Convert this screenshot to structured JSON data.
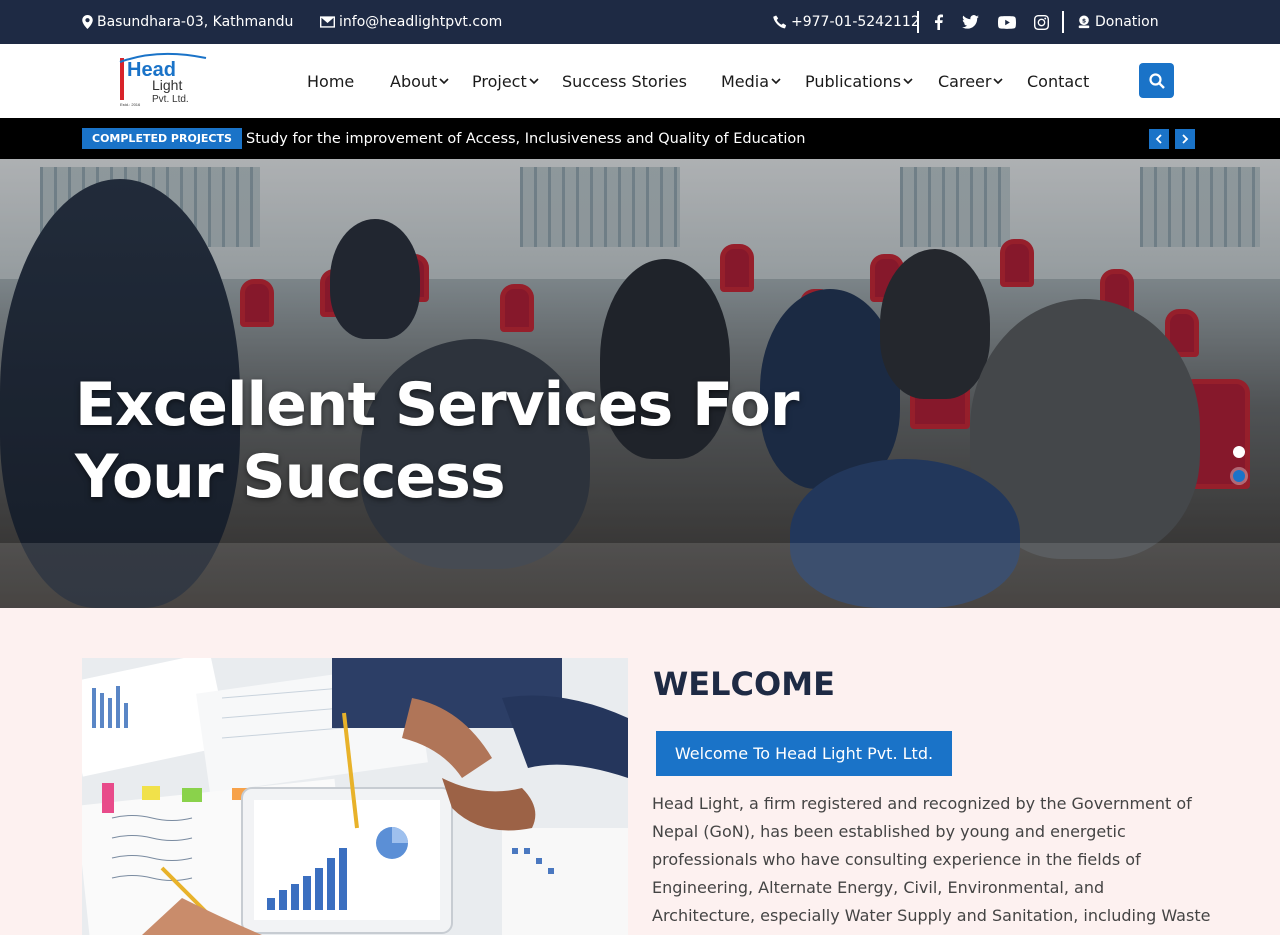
{
  "topbar": {
    "address": "Basundhara-03, Kathmandu",
    "email": "info@headlightpvt.com",
    "phone": "+977-01-5242112",
    "donation": "Donation",
    "social": [
      "facebook-icon",
      "twitter-icon",
      "youtube-icon",
      "instagram-icon"
    ]
  },
  "logo": {
    "line1": "Head",
    "line2": "Light",
    "line3": "Pvt. Ltd.",
    "est": "Estd.: 2016"
  },
  "nav": {
    "items": [
      {
        "label": "Home",
        "dropdown": false
      },
      {
        "label": "About",
        "dropdown": true
      },
      {
        "label": "Project",
        "dropdown": true
      },
      {
        "label": "Success Stories",
        "dropdown": false
      },
      {
        "label": "Media",
        "dropdown": true
      },
      {
        "label": "Publications",
        "dropdown": true
      },
      {
        "label": "Career",
        "dropdown": true
      },
      {
        "label": "Contact",
        "dropdown": false
      }
    ]
  },
  "ticker": {
    "badge": "COMPLETED PROJECTS",
    "text": "Study for the improvement of Access, Inclusiveness and Quality of Education"
  },
  "hero": {
    "line1": "Excellent Services For",
    "line2": "Your Success",
    "slides_count": 2,
    "active_slide": 2
  },
  "welcome": {
    "title": "WELCOME",
    "button": "Welcome To Head Light Pvt. Ltd.",
    "text": "Head Light, a firm registered and recognized by the Government of Nepal (GoN), has been established by young and energetic professionals who have consulting experience in the fields of Engineering, Alternate Energy, Civil, Environmental, and Architecture, especially Water Supply and Sanitation, including Waste"
  },
  "colors": {
    "topbar": "#1e2a44",
    "accent": "#1a73c8",
    "section_bg": "#fdf1f0"
  }
}
